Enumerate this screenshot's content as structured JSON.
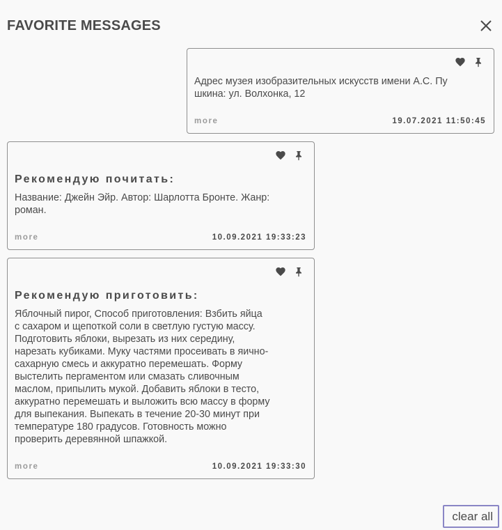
{
  "header": {
    "title": "FAVORITE MESSAGES"
  },
  "icons": {
    "close": "close-icon",
    "favorite": "heart-icon",
    "pin": "pin-icon"
  },
  "messages": [
    {
      "title": "",
      "body": "Адрес музея изобразительных искусств имени А.С. Пу\nшкина: ул. Волхонка, 12",
      "more_label": "more",
      "timestamp": "19.07.2021 11:50:45"
    },
    {
      "title": "Рекомендую почитать:",
      "body": "Название: Джейн Эйр. Автор: Шарлотта Бронте. Жанр:\nроман.",
      "more_label": "more",
      "timestamp": "10.09.2021 19:33:23"
    },
    {
      "title": "Рекомендую приготовить:",
      "body": "Яблочный пирог, Способ приготовления: Взбить яйца\nс сахаром и щепоткой соли в светлую густую массу.\nПодготовить яблоки, вырезать из них середину,\nнарезать кубиками. Муку частями просеивать в яично-\nсахарную смесь и аккуратно перемешать. Форму\nвыстелить пергаментом или смазать сливочным\nмаслом, припылить мукой. Добавить яблоки в тесто,\nаккуратно перемешать и выложить всю массу в форму\nдля выпекания. Выпекать в течение 20-30 минут при\nтемпературе 180 градусов. Готовность можно\nпроверить деревянной шпажкой.",
      "more_label": "more",
      "timestamp": "10.09.2021 19:33:30"
    }
  ],
  "footer": {
    "clear_label": "clear all"
  },
  "colors": {
    "text": "#4a4a4a",
    "muted": "#9b9b9b",
    "border": "#8f8f8f",
    "accent": "#8a86c5",
    "background": "#f9f9f9"
  }
}
